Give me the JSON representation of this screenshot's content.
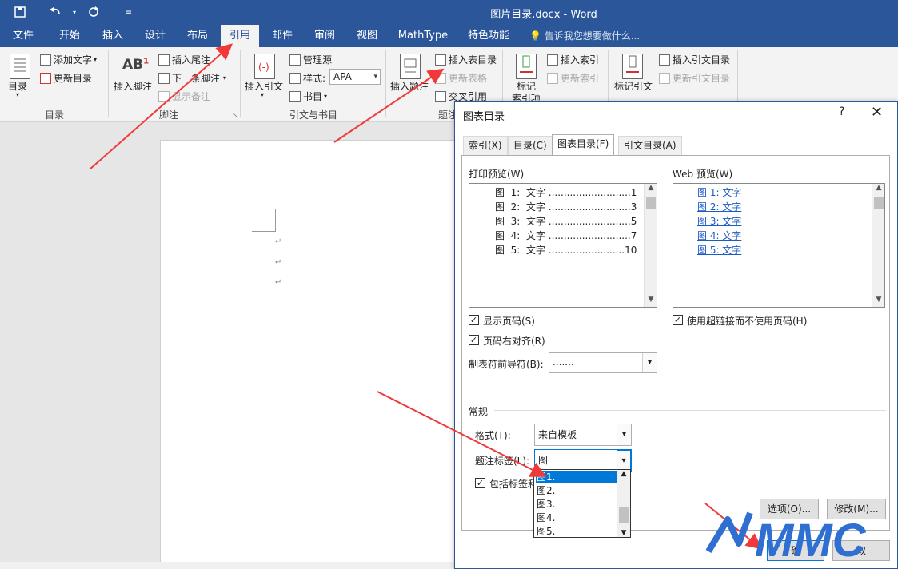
{
  "window": {
    "title": "图片目录.docx - Word"
  },
  "tabs": [
    "文件",
    "开始",
    "插入",
    "设计",
    "布局",
    "引用",
    "邮件",
    "审阅",
    "视图",
    "MathType",
    "特色功能"
  ],
  "tell_me": "告诉我您想要做什么...",
  "ribbon": {
    "toc": {
      "big": "目录",
      "add_text": "添加文字",
      "update": "更新目录",
      "group": "目录"
    },
    "footnote": {
      "big": "插入脚注",
      "endnote": "插入尾注",
      "next": "下一条脚注",
      "show": "显示备注",
      "group": "脚注"
    },
    "citation": {
      "big": "插入引文",
      "manage": "管理源",
      "style_label": "样式:",
      "style_value": "APA",
      "biblio": "书目",
      "group": "引文与书目"
    },
    "caption": {
      "big": "插入题注",
      "insert_table": "插入表目录",
      "update_table": "更新表格",
      "cross_ref": "交叉引用",
      "group": "题注"
    },
    "index": {
      "big_line1": "标记",
      "big_line2": "索引项",
      "insert": "插入索引",
      "update": "更新索引"
    },
    "toa": {
      "big": "标记引文",
      "insert": "插入引文目录",
      "update": "更新引文目录"
    }
  },
  "dialog": {
    "title": "图表目录",
    "help": "?",
    "close": "✕",
    "tabs": [
      "索引(X)",
      "目录(C)",
      "图表目录(F)",
      "引文目录(A)"
    ],
    "print_preview_label": "打印预览(W)",
    "web_preview_label": "Web 预览(W)",
    "print_entries": [
      "图  1:  文字 ...........................1",
      "图  2:  文字 ...........................3",
      "图  3:  文字 ...........................5",
      "图  4:  文字 ...........................7",
      "图  5:  文字 .........................10"
    ],
    "web_entries": [
      "图 1: 文字",
      "图 2: 文字",
      "图 3: 文字",
      "图 4: 文字",
      "图 5: 文字"
    ],
    "show_page_numbers": "显示页码(S)",
    "right_align": "页码右对齐(R)",
    "tab_leader_label": "制表符前导符(B):",
    "tab_leader_value": ".......",
    "use_hyperlinks": "使用超链接而不使用页码(H)",
    "general": "常规",
    "format_label": "格式(T):",
    "format_value": "来自模板",
    "caption_label": "题注标签(L):",
    "caption_value": "图",
    "include_label": "包括标签和",
    "options_btn": "选项(O)...",
    "modify_btn": "修改(M)...",
    "ok_btn": "确",
    "cancel_btn": "取",
    "dropdown_items": [
      "图1.",
      "图2.",
      "图3.",
      "图4.",
      "图5."
    ]
  },
  "watermark": "MMC",
  "colors": {
    "accent": "#2b579a",
    "arrow": "#f03a3a",
    "link": "#1d5bc4",
    "mmc": "#2e6fd1"
  }
}
